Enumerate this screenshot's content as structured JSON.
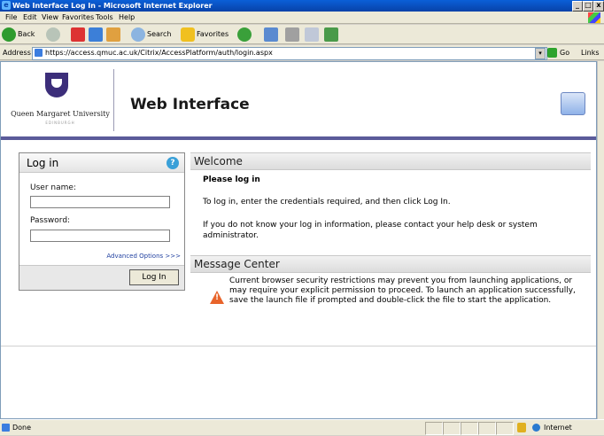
{
  "window": {
    "title": "Web Interface Log In - Microsoft Internet Explorer",
    "minimize": "_",
    "maximize": "□",
    "close": "x"
  },
  "menu": [
    "File",
    "Edit",
    "View",
    "Favorites",
    "Tools",
    "Help"
  ],
  "toolbar": {
    "back": "Back",
    "search": "Search",
    "favorites": "Favorites"
  },
  "address": {
    "label": "Address",
    "url": "https://access.qmuc.ac.uk/Citrix/AccessPlatform/auth/login.aspx",
    "go": "Go",
    "links": "Links"
  },
  "header": {
    "org_name": "Queen Margaret University",
    "org_sub": "EDINBURGH",
    "title": "Web Interface"
  },
  "login": {
    "heading": "Log in",
    "username_label": "User name:",
    "username_value": "",
    "password_label": "Password:",
    "password_value": "",
    "advanced_link": "Advanced Options >>>",
    "button": "Log In"
  },
  "welcome": {
    "heading": "Welcome",
    "title": "Please log in",
    "p1": "To log in, enter the credentials required, and then click Log In.",
    "p2": "If you do not know your log in information, please contact your help desk or system administrator."
  },
  "message_center": {
    "heading": "Message Center",
    "message": "Current browser security restrictions may prevent you from launching applications, or may require your explicit permission to proceed. To launch an application successfully, save the launch file if prompted and double-click the file to start the application."
  },
  "status": {
    "text": "Done",
    "zone": "Internet"
  },
  "colors": {
    "titlebar": "#0842a8",
    "header_rule": "#5b5b9a",
    "warning": "#e8642b"
  }
}
